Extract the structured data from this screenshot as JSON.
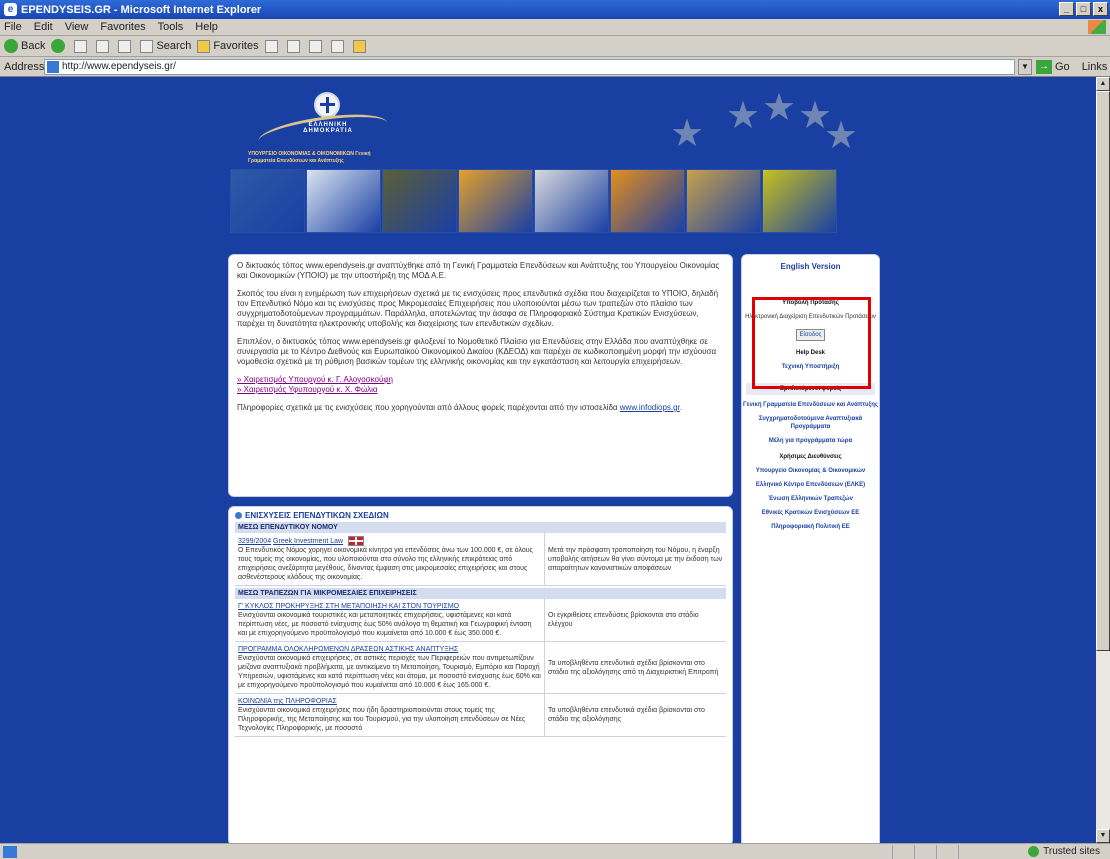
{
  "window": {
    "title": "EPENDYSEIS.GR - Microsoft Internet Explorer",
    "buttons": [
      "_",
      "□",
      "x"
    ]
  },
  "menu": [
    "File",
    "Edit",
    "View",
    "Favorites",
    "Tools",
    "Help"
  ],
  "toolbar": {
    "back": "Back",
    "search": "Search",
    "favorites": "Favorites"
  },
  "address": {
    "label": "Address",
    "url": "http://www.ependyseis.gr/",
    "go": "Go",
    "links": "Links"
  },
  "status": {
    "zone": "Trusted sites"
  },
  "header": {
    "republic": "ΕΛΛΗΝΙΚΗ ΔΗΜΟΚΡΑΤΙΑ",
    "ministry": "ΥΠΟΥΡΓΕΙΟ ΟΙΚΟΝΟΜΙΑΣ & ΟΙΚΟΝΟΜΙΚΩΝ Γενική Γραμματεία Επενδύσεων και Ανάπτυξης",
    "tile_colors": [
      "#2e5aa6",
      "#d9e4f0",
      "#5c5f36",
      "#e3a12a",
      "#d8d9db",
      "#e58f1c",
      "#c8a24a",
      "#c8c21e"
    ]
  },
  "intro": {
    "p1": "Ο δικτυακός τόπος www.ependyseis.gr αναπτύχθηκε από τη Γενική Γραμματεία Επενδύσεων και Ανάπτυξης του Υπουργείου Οικονομίας και Οικονομικών (ΥΠΟΙΟ) με την υποστήριξη της ΜΟΔ Α.Ε.",
    "p2": "Σκοπός του είναι η ενημέρωση των επιχειρήσεων σχετικά με τις ενισχύσεις προς επενδυτικά σχέδια που διαχειρίζεται το ΥΠΟΙΟ, δηλαδή τον Επενδυτικό Νόμο και τις ενισχύσεις προς Μικρομεσαίες Επιχειρήσεις που υλοποιούνται μέσω των τραπεζών στο πλαίσιο των συγχρηματοδοτούμενων προγραμμάτων. Παράλληλα, αποτελώντας την άσαφα σε Πληροφοριακό Σύστημα Κρατικών Ενισχύσεων, παρέχει τη δυνατότητα ηλεκτρονικής υποβολής και διαχείρισης των επενδυτικών σχεδίων.",
    "p3": "Επιπλέον, ο δικτυακός τόπος www.ependyseis.gr φιλοξενεί το Νομοθετικό Πλαίσιο για Επενδύσεις στην Ελλάδα που αναπτύχθηκε σε συνεργασία με το Κέντρο Διεθνούς και Ευρωπαϊκού Οικονομικού Δικαίου (ΚΔΕΟΔ) και παρέχει σε κωδικοποιημένη μορφή την ισχύουσα νομοθεσία σχετικά με τη ρύθμιση βασικών τομέων της ελληνικής οικονομίας και την εγκατάσταση και λειτουργία επιχειρήσεων.",
    "link1": "» Χαιρετισμός Υπουργού κ. Γ. Αλογοσκούφη",
    "link2": "» Χαιρετισμός Υφυπουργού κ. Χ. Φώλια",
    "p4": "Πληροφορίες σχετικά με τις ενισχύσεις που χορηγούνται από άλλους φορείς παρέχονται από την ιστοσελίδα",
    "p4_link": "www.infodiops.gr",
    "p4_end": "."
  },
  "schedules": {
    "heading": "ΕΝΙΣΧΥΣΕΙΣ ΕΠΕΝΔΥΤΙΚΩΝ ΣΧΕΔΙΩΝ",
    "section1": "ΜΕΣΩ ΕΠΕΝΔΥΤΙΚΟΥ ΝΟΜΟΥ",
    "row1": {
      "date": "3299/2004",
      "link": "Greek Investment Law",
      "text": "Ο Επενδυτικός Νόμος χορηγεί οικονομικά κίνητρα για επενδύσεις άνω των 100.000 €, σε όλους τους τομείς της οικονομίας, που υλοποιούνται στο σύνολο της ελληνικής επικράτειας από επιχειρήσεις ανεξάρτητα μεγέθους, δίνοντας έμφαση στις μικρομεσαίες επιχειρήσεις και στους ασθενέστερους κλάδους της οικονομίας.",
      "status": "Μετά την πρόσφατη τροποποίηση του Νόμου, η έναρξη υποβολής αιτήσεων θα γίνει σύντομα με την έκδοση των απαραίτητων κανονιστικών αποφάσεων"
    },
    "section2": "ΜΕΣΩ ΤΡΑΠΕΖΩΝ ΓΙΑ ΜΙΚΡΟΜΕΣΑΙΕΣ ΕΠΙΧΕΙΡΗΣΕΙΣ",
    "row2": {
      "link": "Γ' ΚΥΚΛΟΣ ΠΡΟΚΗΡΥΞΗΣ ΣΤΗ ΜΕΤΑΠΟΙΗΣΗ ΚΑΙ ΣΤΟΝ ΤΟΥΡΙΣΜΟ",
      "text": "Ενισχύονται οικονομικά τουριστικές και μεταποιητικές επιχειρήσεις, υφιστάμενες και κατά περίπτωση νέες, με ποσοστό ενίσχυσης έως 50% ανάλογα τη θεματική και Γεωγραφική ένταση και με επιχορηγούμενο προϋπολογισμό που κυμαίνεται από 10.000 € έως 350.000 €.",
      "status": "Οι εγκριθείσες επενδύσεις βρίσκονται στο στάδιο ελέγχου"
    },
    "row3": {
      "link": "ΠΡΟΓΡΑΜΜΑ ΟΛΟΚΛΗΡΩΜΕΝΩΝ ΔΡΑΣΕΩΝ ΑΣΤΙΚΗΣ ΑΝΑΠΤΥΞΗΣ",
      "text": "Ενισχύονται οικονομικά επιχειρήσεις, σε αστικές περιοχές των Περιφερειών που αντιμετωπίζουν μείζονα αναπτυξιακά προβλήματα, με αντικείμενο τη Μεταποίηση, Τουρισμό, Εμπόριο και Παροχή Υπηρεσιών, υφιστάμενες και κατά περίπτωση νέες και άτομα, με ποσοστό ενίσχυσης έως 60% και με επιχορηγούμενο προϋπολογισμό που κυμαίνεται από 10.000 € έως 165.000 €.",
      "status": "Τα υποβληθέντα επενδυτικά σχέδια βρίσκονται στο στάδιο της αξιολόγησης από τη Διαχειριστική Επιτροπή"
    },
    "row4": {
      "link": "ΚΟΙΝΩΝΙΑ της ΠΛΗΡΟΦΟΡΙΑΣ",
      "text": "Ενισχύονται οικονομικά επιχειρήσεις που ήδη δραστηριοποιούνται στους τομείς της Πληροφορικής, της Μεταποίησης και του Τουρισμού, για την υλοποίηση επενδύσεων σε Νέες Τεχνολογίες Πληροφορικής, με ποσοστό",
      "status": "Τα υποβληθέντα επενδυτικά σχέδια βρίσκονται στο στάδιο της αξιολόγησης"
    }
  },
  "sidebar": {
    "english": "English Version",
    "submit_title": "Υποβολή Πρότασης",
    "submit_sub": "Ηλεκτρονική Διαχείριση Επενδυτικών Προτάσεων",
    "login": "Είσοδος",
    "helpdesk": "Help Desk",
    "support": "Τεχνική Υποστήριξη",
    "bodies": "Εμπλεκόμενοι φορείς",
    "body1": "Γενική Γραμματεία Επενδύσεων και Ανάπτυξης",
    "body2": "Συγχρηματοδοτούμενα Αναπτυξιακά Προγράμματα",
    "body3": "Μέλη για προγράμματα τώρα",
    "links_title": "Χρήσιμες Διευθύνσεις",
    "link1": "Υπουργείο Οικονομίας & Οικονομικών",
    "link2": "Ελληνικό Κέντρο Επενδύσεων (ΕΛΚΕ)",
    "link3": "Ένωση Ελληνικών Τραπεζών",
    "link4": "Εθνικές Κρατικών Ενισχύσεων ΕΕ",
    "link5": "Πληροφοριακή Πολιτική ΕΕ"
  }
}
